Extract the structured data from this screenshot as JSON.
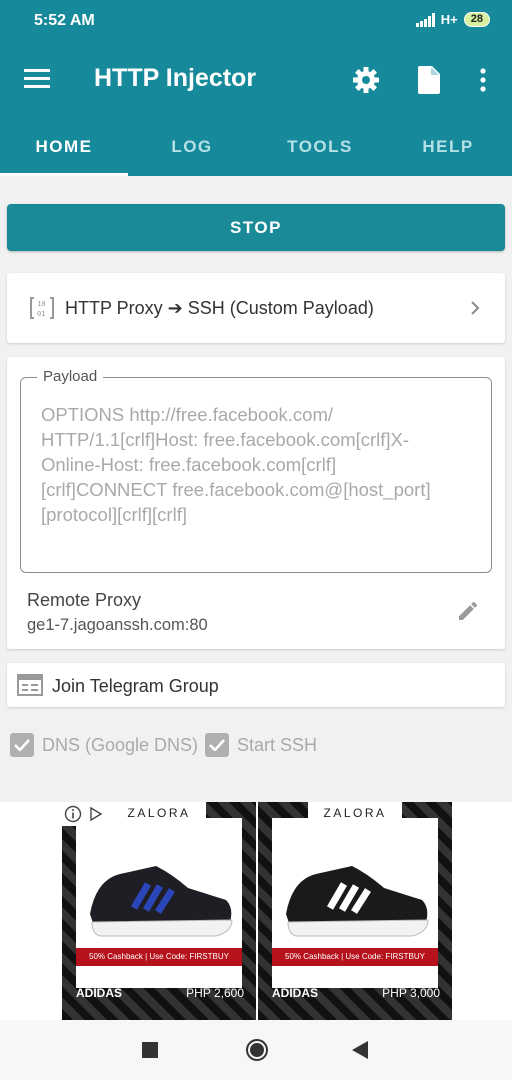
{
  "status": {
    "time": "5:52 AM",
    "network": "H+",
    "battery": "28"
  },
  "appbar": {
    "title": "HTTP Injector"
  },
  "tabs": [
    {
      "label": "HOME",
      "active": true
    },
    {
      "label": "LOG",
      "active": false
    },
    {
      "label": "TOOLS",
      "active": false
    },
    {
      "label": "HELP",
      "active": false
    }
  ],
  "actions": {
    "stop_label": "STOP"
  },
  "method": {
    "label": "HTTP Proxy ➔ SSH (Custom Payload)"
  },
  "payload": {
    "legend": "Payload",
    "text": "OPTIONS http://free.facebook.com/ HTTP/1.1[crlf]Host: free.facebook.com[crlf]X-Online-Host: free.facebook.com[crlf][crlf]CONNECT free.facebook.com@[host_port] [protocol][crlf][crlf]"
  },
  "remote_proxy": {
    "label": "Remote Proxy",
    "value": "ge1-7.jagoanssh.com:80"
  },
  "telegram": {
    "label": "Join Telegram Group"
  },
  "options": {
    "dns": "DNS (Google DNS)",
    "ssh": "Start SSH"
  },
  "ads": [
    {
      "store": "ZALORA",
      "promo": "50% Cashback | Use Code: FIRSTBUY",
      "brand": "ADIDAS",
      "price": "PHP 2,600"
    },
    {
      "store": "ZALORA",
      "promo": "50% Cashback | Use Code: FIRSTBUY",
      "brand": "ADIDAS",
      "price": "PHP 3,000"
    }
  ],
  "colors": {
    "primary": "#168a9a",
    "accent": "#1a8a99",
    "promo_red": "#b5121b"
  }
}
